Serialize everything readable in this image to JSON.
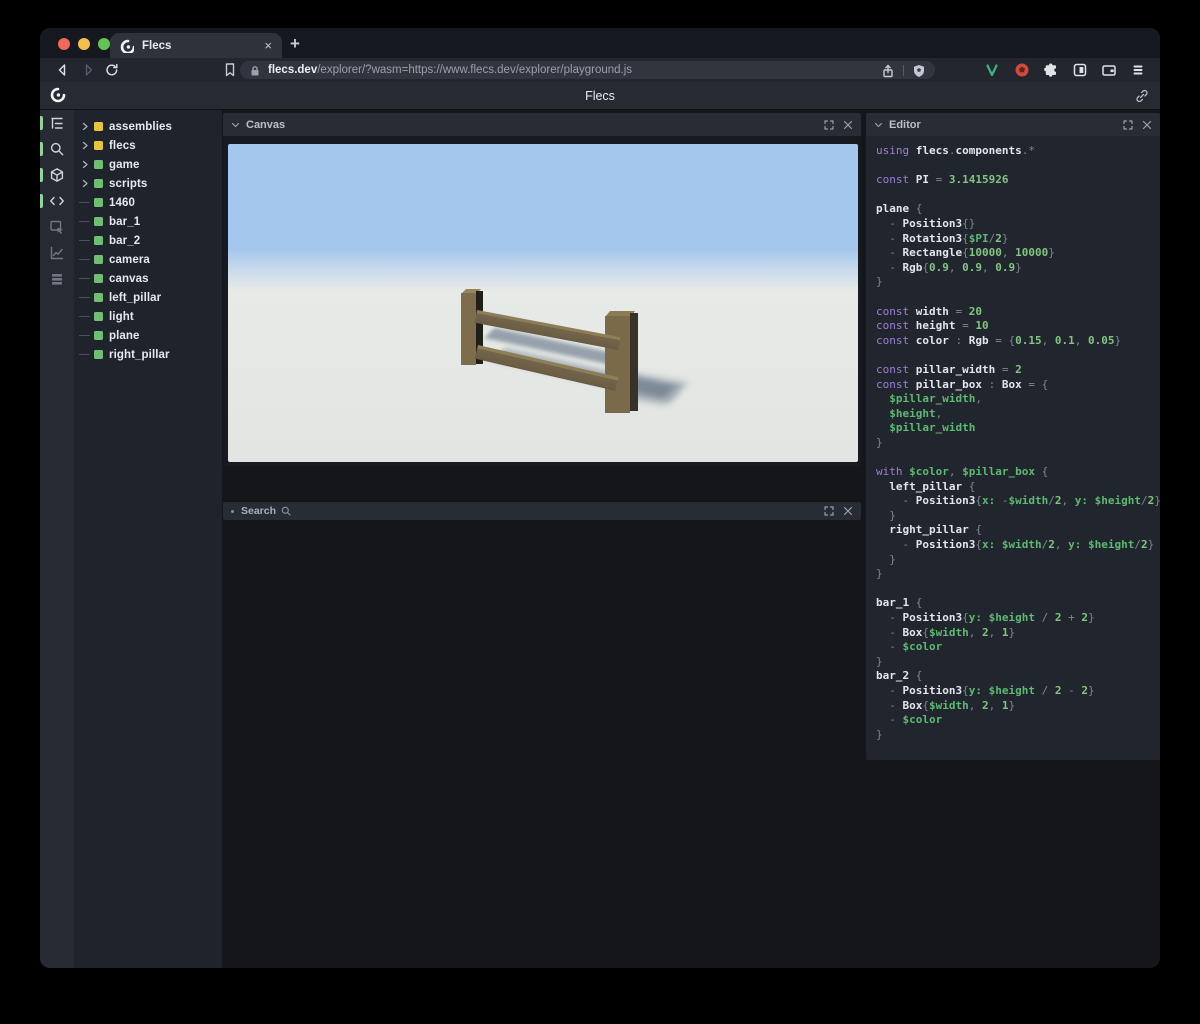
{
  "browser": {
    "tab": {
      "title": "Flecs",
      "close_glyph": "×"
    },
    "new_tab_glyph": "+",
    "url": {
      "domain": "flecs.dev",
      "path": "/explorer/?wasm=https://www.flecs.dev/explorer/playground.js"
    },
    "action_icons": [
      "vue-devtools-icon",
      "brave-rewards-icon",
      "extensions-puzzle-icon",
      "sidebar-toggle-icon",
      "wallet-icon",
      "menu-icon"
    ]
  },
  "header": {
    "title": "Flecs"
  },
  "rail": {
    "items": [
      {
        "icon": "tree-icon",
        "active": true
      },
      {
        "icon": "search-icon",
        "active": true
      },
      {
        "icon": "cube-icon",
        "active": true
      },
      {
        "icon": "code-icon",
        "active": true
      },
      {
        "icon": "inspector-icon",
        "active": false
      },
      {
        "icon": "chart-icon",
        "active": false
      },
      {
        "icon": "rows-icon",
        "active": false
      }
    ]
  },
  "tree": {
    "items": [
      {
        "label": "assemblies",
        "dot": "#e5c445",
        "expandable": true
      },
      {
        "label": "flecs",
        "dot": "#e5c445",
        "expandable": true
      },
      {
        "label": "game",
        "dot": "#6fbe71",
        "expandable": true
      },
      {
        "label": "scripts",
        "dot": "#6fbe71",
        "expandable": true
      },
      {
        "label": "1460",
        "dot": "#6fbe71",
        "expandable": false
      },
      {
        "label": "bar_1",
        "dot": "#6fbe71",
        "expandable": false
      },
      {
        "label": "bar_2",
        "dot": "#6fbe71",
        "expandable": false
      },
      {
        "label": "camera",
        "dot": "#6fbe71",
        "expandable": false
      },
      {
        "label": "canvas",
        "dot": "#6fbe71",
        "expandable": false
      },
      {
        "label": "left_pillar",
        "dot": "#6fbe71",
        "expandable": false
      },
      {
        "label": "light",
        "dot": "#6fbe71",
        "expandable": false
      },
      {
        "label": "plane",
        "dot": "#6fbe71",
        "expandable": false
      },
      {
        "label": "right_pillar",
        "dot": "#6fbe71",
        "expandable": false
      }
    ]
  },
  "panels": {
    "canvas": {
      "title": "Canvas"
    },
    "search": {
      "title": "Search"
    },
    "editor": {
      "title": "Editor"
    }
  },
  "scene": {
    "sky_color": "#a4c7ee",
    "ground_color": "#e2e5e1",
    "fence_color": "#7a6a4a",
    "objects": [
      "plane",
      "left_pillar",
      "right_pillar",
      "bar_1",
      "bar_2"
    ]
  },
  "code": {
    "lines": [
      [
        [
          "kw",
          "using "
        ],
        [
          "id",
          "flecs"
        ],
        [
          "pun",
          "."
        ],
        [
          "id",
          "components"
        ],
        [
          "pun",
          ".*"
        ]
      ],
      [],
      [
        [
          "kw",
          "const "
        ],
        [
          "id",
          "PI"
        ],
        [
          "pun",
          " = "
        ],
        [
          "num",
          "3.1415926"
        ]
      ],
      [],
      [
        [
          "id",
          "plane"
        ],
        [
          "pun",
          " {"
        ]
      ],
      [
        [
          "pun",
          "  - "
        ],
        [
          "id",
          "Position3"
        ],
        [
          "pun",
          "{}"
        ]
      ],
      [
        [
          "pun",
          "  - "
        ],
        [
          "id",
          "Rotation3"
        ],
        [
          "pun",
          "{"
        ],
        [
          "var",
          "$PI"
        ],
        [
          "pun",
          "/"
        ],
        [
          "num",
          "2"
        ],
        [
          "pun",
          "}"
        ]
      ],
      [
        [
          "pun",
          "  - "
        ],
        [
          "id",
          "Rectangle"
        ],
        [
          "pun",
          "{"
        ],
        [
          "num",
          "10000"
        ],
        [
          "pun",
          ", "
        ],
        [
          "num",
          "10000"
        ],
        [
          "pun",
          "}"
        ]
      ],
      [
        [
          "pun",
          "  - "
        ],
        [
          "id",
          "Rgb"
        ],
        [
          "pun",
          "{"
        ],
        [
          "num",
          "0.9"
        ],
        [
          "pun",
          ", "
        ],
        [
          "num",
          "0.9"
        ],
        [
          "pun",
          ", "
        ],
        [
          "num",
          "0.9"
        ],
        [
          "pun",
          "}"
        ]
      ],
      [
        [
          "pun",
          "}"
        ]
      ],
      [],
      [
        [
          "kw",
          "const "
        ],
        [
          "id",
          "width"
        ],
        [
          "pun",
          " = "
        ],
        [
          "num",
          "20"
        ]
      ],
      [
        [
          "kw",
          "const "
        ],
        [
          "id",
          "height"
        ],
        [
          "pun",
          " = "
        ],
        [
          "num",
          "10"
        ]
      ],
      [
        [
          "kw",
          "const "
        ],
        [
          "id",
          "color"
        ],
        [
          "pun",
          " : "
        ],
        [
          "id",
          "Rgb"
        ],
        [
          "pun",
          " = {"
        ],
        [
          "num",
          "0.15"
        ],
        [
          "pun",
          ", "
        ],
        [
          "num",
          "0.1"
        ],
        [
          "pun",
          ", "
        ],
        [
          "num",
          "0.05"
        ],
        [
          "pun",
          "}"
        ]
      ],
      [],
      [
        [
          "kw",
          "const "
        ],
        [
          "id",
          "pillar_width"
        ],
        [
          "pun",
          " = "
        ],
        [
          "num",
          "2"
        ]
      ],
      [
        [
          "kw",
          "const "
        ],
        [
          "id",
          "pillar_box"
        ],
        [
          "pun",
          " : "
        ],
        [
          "id",
          "Box"
        ],
        [
          "pun",
          " = {"
        ]
      ],
      [
        [
          "var",
          "  $pillar_width"
        ],
        [
          "pun",
          ","
        ]
      ],
      [
        [
          "var",
          "  $height"
        ],
        [
          "pun",
          ","
        ]
      ],
      [
        [
          "var",
          "  $pillar_width"
        ]
      ],
      [
        [
          "pun",
          "}"
        ]
      ],
      [],
      [
        [
          "kw",
          "with "
        ],
        [
          "var",
          "$color"
        ],
        [
          "pun",
          ", "
        ],
        [
          "var",
          "$pillar_box"
        ],
        [
          "pun",
          " {"
        ]
      ],
      [
        [
          "id",
          "  left_pillar"
        ],
        [
          "pun",
          " {"
        ]
      ],
      [
        [
          "pun",
          "    - "
        ],
        [
          "id",
          "Position3"
        ],
        [
          "pun",
          "{"
        ],
        [
          "var",
          "x:"
        ],
        [
          "pun",
          " -"
        ],
        [
          "var",
          "$width"
        ],
        [
          "pun",
          "/"
        ],
        [
          "num",
          "2"
        ],
        [
          "pun",
          ", "
        ],
        [
          "var",
          "y:"
        ],
        [
          "pun",
          " "
        ],
        [
          "var",
          "$height"
        ],
        [
          "pun",
          "/"
        ],
        [
          "num",
          "2"
        ],
        [
          "pun",
          "}"
        ]
      ],
      [
        [
          "pun",
          "  }"
        ]
      ],
      [
        [
          "id",
          "  right_pillar"
        ],
        [
          "pun",
          " {"
        ]
      ],
      [
        [
          "pun",
          "    - "
        ],
        [
          "id",
          "Position3"
        ],
        [
          "pun",
          "{"
        ],
        [
          "var",
          "x:"
        ],
        [
          "pun",
          " "
        ],
        [
          "var",
          "$width"
        ],
        [
          "pun",
          "/"
        ],
        [
          "num",
          "2"
        ],
        [
          "pun",
          ", "
        ],
        [
          "var",
          "y:"
        ],
        [
          "pun",
          " "
        ],
        [
          "var",
          "$height"
        ],
        [
          "pun",
          "/"
        ],
        [
          "num",
          "2"
        ],
        [
          "pun",
          "}"
        ]
      ],
      [
        [
          "pun",
          "  }"
        ]
      ],
      [
        [
          "pun",
          "}"
        ]
      ],
      [],
      [
        [
          "id",
          "bar_1"
        ],
        [
          "pun",
          " {"
        ]
      ],
      [
        [
          "pun",
          "  - "
        ],
        [
          "id",
          "Position3"
        ],
        [
          "pun",
          "{"
        ],
        [
          "var",
          "y:"
        ],
        [
          "pun",
          " "
        ],
        [
          "var",
          "$height"
        ],
        [
          "pun",
          " / "
        ],
        [
          "num",
          "2"
        ],
        [
          "pun",
          " + "
        ],
        [
          "num",
          "2"
        ],
        [
          "pun",
          "}"
        ]
      ],
      [
        [
          "pun",
          "  - "
        ],
        [
          "id",
          "Box"
        ],
        [
          "pun",
          "{"
        ],
        [
          "var",
          "$width"
        ],
        [
          "pun",
          ", "
        ],
        [
          "num",
          "2"
        ],
        [
          "pun",
          ", "
        ],
        [
          "num",
          "1"
        ],
        [
          "pun",
          "}"
        ]
      ],
      [
        [
          "pun",
          "  - "
        ],
        [
          "var",
          "$color"
        ]
      ],
      [
        [
          "pun",
          "}"
        ]
      ],
      [
        [
          "id",
          "bar_2"
        ],
        [
          "pun",
          " {"
        ]
      ],
      [
        [
          "pun",
          "  - "
        ],
        [
          "id",
          "Position3"
        ],
        [
          "pun",
          "{"
        ],
        [
          "var",
          "y:"
        ],
        [
          "pun",
          " "
        ],
        [
          "var",
          "$height"
        ],
        [
          "pun",
          " / "
        ],
        [
          "num",
          "2"
        ],
        [
          "pun",
          " - "
        ],
        [
          "num",
          "2"
        ],
        [
          "pun",
          "}"
        ]
      ],
      [
        [
          "pun",
          "  - "
        ],
        [
          "id",
          "Box"
        ],
        [
          "pun",
          "{"
        ],
        [
          "var",
          "$width"
        ],
        [
          "pun",
          ", "
        ],
        [
          "num",
          "2"
        ],
        [
          "pun",
          ", "
        ],
        [
          "num",
          "1"
        ],
        [
          "pun",
          "}"
        ]
      ],
      [
        [
          "pun",
          "  - "
        ],
        [
          "var",
          "$color"
        ]
      ],
      [
        [
          "pun",
          "}"
        ]
      ]
    ]
  }
}
